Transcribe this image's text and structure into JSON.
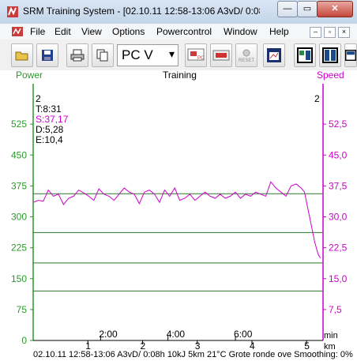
{
  "window": {
    "title": "SRM Training System - [02.10.11 12:58-13:06 A3vD/ 0:08...",
    "close_glyph": "✕",
    "minimize_glyph": "—",
    "maximize_glyph": "▭"
  },
  "menu": {
    "items": [
      "File",
      "Edit",
      "View",
      "Options",
      "Powercontrol",
      "Window",
      "Help"
    ],
    "mdi_buttons": [
      "–",
      "▫",
      "×"
    ]
  },
  "toolbar": {
    "buttons": [
      "open-icon",
      "save-icon",
      "print-icon",
      "copy-icon",
      "pc-download-icon",
      "reset-memory-icon",
      "reset-icon",
      "export-icon",
      "layout-1-icon",
      "layout-2-icon",
      "layout-3-icon"
    ],
    "combo_value": "PC V",
    "pc_label": "PC",
    "reset_label": "RESET"
  },
  "chart_header": {
    "left_axis_name": "Power",
    "center_title": "Training",
    "right_axis_name": "Speed"
  },
  "stats": {
    "lap_left": "2",
    "lap_right": "2",
    "time": "T:8:31",
    "speed": "S:37,17",
    "distance": "D:5,28",
    "energy": "E:10,4"
  },
  "chart_data": {
    "type": "line",
    "left_axis": {
      "label": "Power",
      "ticks": [
        "0",
        "75",
        "150",
        "225",
        "300",
        "375",
        "450",
        "525"
      ],
      "ylim": [
        0,
        600
      ]
    },
    "right_axis": {
      "label": "Speed",
      "ticks": [
        "7,5",
        "15,0",
        "22,5",
        "30,0",
        "37,5",
        "45,0",
        "52,5"
      ],
      "ylim": [
        0,
        60
      ]
    },
    "time_ticks": [
      "2:00",
      "4:00",
      "6:00"
    ],
    "time_unit": "min",
    "km_ticks": [
      "1",
      "2",
      "3",
      "4",
      "5"
    ],
    "km_unit": "km",
    "zone_lines_power": [
      120,
      188,
      262,
      356
    ],
    "series": [
      {
        "color": "#cc00cc",
        "x_min": [
          0,
          0.15,
          0.3,
          0.45,
          0.6,
          0.75,
          0.9,
          1.05,
          1.2,
          1.35,
          1.5,
          1.65,
          1.8,
          1.95,
          2.1,
          2.25,
          2.4,
          2.55,
          2.7,
          2.85,
          3.0,
          3.15,
          3.3,
          3.45,
          3.6,
          3.75,
          3.9,
          4.05,
          4.2,
          4.35,
          4.5,
          4.65,
          4.8,
          4.95,
          5.1,
          5.25,
          5.4,
          5.55,
          5.7,
          5.85,
          6.0,
          6.15,
          6.3,
          6.45,
          6.6,
          6.75,
          6.9,
          7.05,
          7.2,
          7.35,
          7.5,
          7.65,
          7.8,
          7.95,
          8.05,
          8.15,
          8.25,
          8.35,
          8.45,
          8.52
        ],
        "speed_kmh": [
          33.5,
          34.0,
          33.8,
          36.5,
          35.0,
          35.5,
          33.0,
          34.5,
          35.0,
          36.5,
          35.8,
          35.0,
          34.0,
          36.8,
          35.5,
          35.0,
          34.0,
          35.5,
          37.0,
          36.0,
          35.5,
          33.2,
          36.0,
          36.5,
          35.5,
          33.5,
          36.5,
          35.0,
          37.0,
          34.0,
          34.5,
          35.5,
          34.0,
          35.0,
          36.0,
          35.0,
          34.5,
          35.5,
          34.5,
          35.0,
          36.0,
          34.5,
          35.5,
          35.0,
          36.0,
          35.5,
          35.0,
          38.5,
          37.0,
          36.0,
          35.0,
          37.5,
          38.0,
          37.0,
          36.0,
          32.0,
          28.0,
          24.0,
          21.0,
          20.0
        ]
      }
    ],
    "title": "Training"
  },
  "status": {
    "text": "02.10.11 12:58-13:06 A3vD/ 0:08h 10kJ 5km 21°C Grote ronde ove  Smoothing: 0%"
  }
}
